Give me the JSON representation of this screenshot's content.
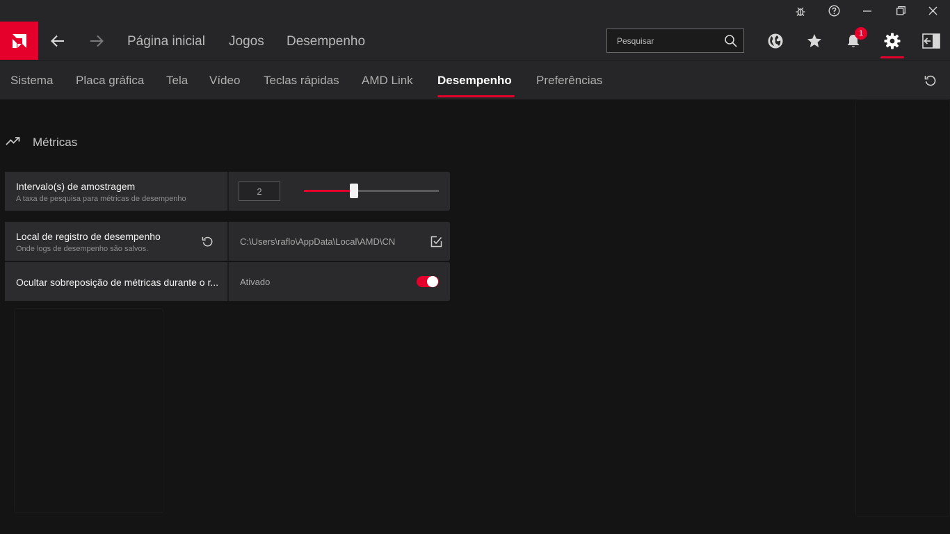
{
  "titlebar": {
    "icons": [
      "bug-icon",
      "help-icon",
      "minimize-icon",
      "restore-icon",
      "close-icon"
    ]
  },
  "header": {
    "logo": "amd-logo",
    "nav_links": [
      "Página inicial",
      "Jogos",
      "Desempenho"
    ],
    "search_placeholder": "Pesquisar",
    "notification_count": "1",
    "icons": [
      "globe-icon",
      "star-icon",
      "bell-icon",
      "gear-icon",
      "exit-panel-icon"
    ]
  },
  "tabs": {
    "items": [
      "Sistema",
      "Placa gráfica",
      "Tela",
      "Vídeo",
      "Teclas rápidas",
      "AMD Link",
      "Desempenho",
      "Preferências"
    ],
    "active": "Desempenho"
  },
  "section": {
    "title": "Métricas"
  },
  "settings": {
    "sampling": {
      "title": "Intervalo(s) de amostragem",
      "subtitle": "A taxa de pesquisa para métricas de desempenho",
      "value": "2",
      "slider_fraction": 0.37
    },
    "log_location": {
      "title": "Local de registro de desempenho",
      "subtitle": "Onde logs de desempenho são salvos.",
      "path": "C:\\Users\\raflo\\AppData\\Local\\AMD\\CN"
    },
    "hide_overlay": {
      "title": "Ocultar sobreposição de métricas durante o r...",
      "value": "Ativado",
      "enabled": true
    }
  },
  "colors": {
    "accent": "#e4002b",
    "background": "#141415",
    "panel": "#262628",
    "card": "#2a2a2c"
  }
}
